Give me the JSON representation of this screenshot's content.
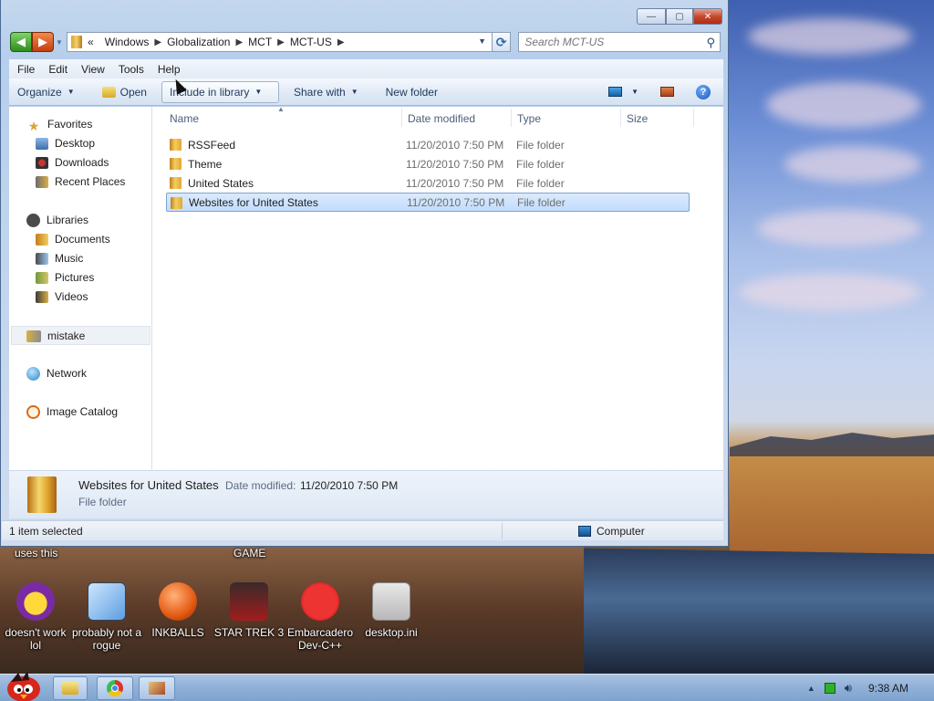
{
  "window": {
    "controls": {
      "minimize": "—",
      "maximize": "▢",
      "close": "✕"
    }
  },
  "address_bar": {
    "overflow": "«",
    "crumbs": [
      "Windows",
      "Globalization",
      "MCT",
      "MCT-US"
    ],
    "search_placeholder": "Search MCT-US"
  },
  "menu": [
    "File",
    "Edit",
    "View",
    "Tools",
    "Help"
  ],
  "command_bar": {
    "organize": "Organize",
    "open": "Open",
    "include_in_library": "Include in library",
    "share_with": "Share with",
    "new_folder": "New folder"
  },
  "nav_pane": {
    "favorites": "Favorites",
    "favorites_items": [
      "Desktop",
      "Downloads",
      "Recent Places"
    ],
    "libraries": "Libraries",
    "library_items": [
      "Documents",
      "Music",
      "Pictures",
      "Videos"
    ],
    "homegroup": "mistake",
    "network": "Network",
    "image_catalog": "Image Catalog"
  },
  "columns": [
    "Name",
    "Date modified",
    "Type",
    "Size"
  ],
  "files": [
    {
      "name": "RSSFeed",
      "date": "11/20/2010 7:50 PM",
      "type": "File folder"
    },
    {
      "name": "Theme",
      "date": "11/20/2010 7:50 PM",
      "type": "File folder"
    },
    {
      "name": "United States",
      "date": "11/20/2010 7:50 PM",
      "type": "File folder"
    },
    {
      "name": "Websites for United States",
      "date": "11/20/2010 7:50 PM",
      "type": "File folder",
      "selected": true
    }
  ],
  "details": {
    "name": "Websites for United States",
    "modified_label": "Date modified:",
    "modified_value": "11/20/2010 7:50 PM",
    "type": "File folder"
  },
  "status": {
    "selection": "1 item selected",
    "location": "Computer"
  },
  "desktop": {
    "partial_labels": [
      "uses this",
      "GAME"
    ],
    "icons": [
      {
        "label": "doesn't work lol"
      },
      {
        "label": "probably not a rogue"
      },
      {
        "label": "INKBALLS"
      },
      {
        "label": "STAR TREK 3"
      },
      {
        "label": "Embarcadero Dev-C++"
      },
      {
        "label": "desktop.ini"
      }
    ]
  },
  "taskbar": {
    "clock": "9:38 AM"
  }
}
